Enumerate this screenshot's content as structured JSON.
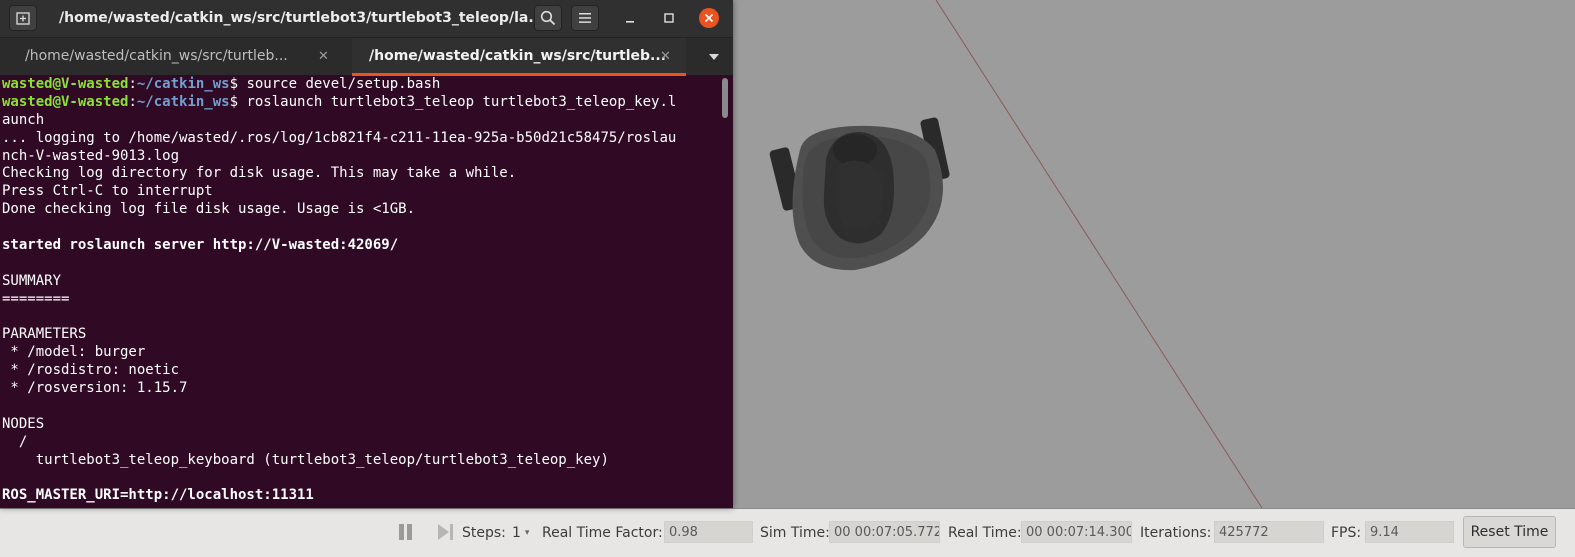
{
  "terminal": {
    "title": "/home/wasted/catkin_ws/src/turtlebot3/turtlebot3_teleop/la...",
    "tabs": [
      {
        "label": "/home/wasted/catkin_ws/src/turtleb...",
        "active": false
      },
      {
        "label": "/home/wasted/catkin_ws/src/turtleb...",
        "active": true
      }
    ],
    "prompt": {
      "user_host": "wasted@V-wasted",
      "path": "~/catkin_ws"
    },
    "commands": [
      "source devel/setup.bash",
      "roslaunch turtlebot3_teleop turtlebot3_teleop_key.l"
    ],
    "output": [
      "aunch",
      "... logging to /home/wasted/.ros/log/1cb821f4-c211-11ea-925a-b50d21c58475/roslau",
      "nch-V-wasted-9013.log",
      "Checking log directory for disk usage. This may take a while.",
      "Press Ctrl-C to interrupt",
      "Done checking log file disk usage. Usage is <1GB.",
      "",
      "started roslaunch server http://V-wasted:42069/",
      "",
      "SUMMARY",
      "========",
      "",
      "PARAMETERS",
      " * /model: burger",
      " * /rosdistro: noetic",
      " * /rosversion: 1.15.7",
      "",
      "NODES",
      "  /",
      "    turtlebot3_teleop_keyboard (turtlebot3_teleop/turtlebot3_teleop_key)",
      "",
      "ROS_MASTER_URI=http://localhost:11311"
    ],
    "colors": {
      "background": "#300a24",
      "prompt_user": "#8ae234",
      "prompt_path": "#729fcf",
      "accent": "#e95420"
    }
  },
  "gazebo": {
    "steps_label": "Steps:",
    "steps_value": "1",
    "rtf_label": "Real Time Factor:",
    "rtf_value": "0.98",
    "sim_time_label": "Sim Time:",
    "sim_time_value": "00 00:07:05.772",
    "real_time_label": "Real Time:",
    "real_time_value": "00 00:07:14.300",
    "iterations_label": "Iterations:",
    "iterations_value": "425772",
    "fps_label": "FPS:",
    "fps_value": "9.14",
    "reset_label": "Reset Time"
  }
}
